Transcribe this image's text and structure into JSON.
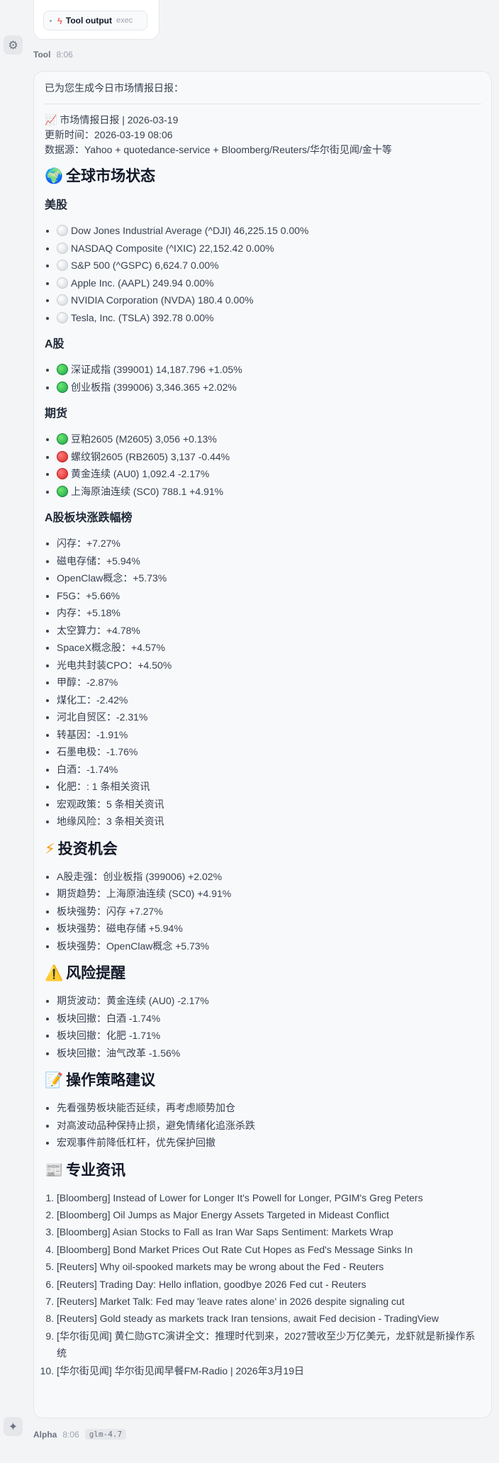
{
  "tool_card": {
    "label": "Tool output",
    "kind": "exec"
  },
  "tool_meta": {
    "name": "Tool",
    "time": "8:06"
  },
  "message": {
    "intro": "已为您生成今日市场情报日报：",
    "report_title": "📈 市场情报日报 | 2026-03-19",
    "updated": "更新时间：2026-03-19 08:06",
    "sources": "数据源：Yahoo + quotedance-service + Bloomberg/Reuters/华尔街见闻/金十等",
    "global": {
      "heading": "全球市场状态",
      "us": {
        "heading": "美股",
        "items": [
          {
            "status": "white",
            "text": "Dow Jones Industrial Average (^DJI) 46,225.15 0.00%"
          },
          {
            "status": "white",
            "text": "NASDAQ Composite (^IXIC) 22,152.42 0.00%"
          },
          {
            "status": "white",
            "text": "S&P 500 (^GSPC) 6,624.7 0.00%"
          },
          {
            "status": "white",
            "text": "Apple Inc. (AAPL) 249.94 0.00%"
          },
          {
            "status": "white",
            "text": "NVIDIA Corporation (NVDA) 180.4 0.00%"
          },
          {
            "status": "white",
            "text": "Tesla, Inc. (TSLA) 392.78 0.00%"
          }
        ]
      },
      "cn": {
        "heading": "A股",
        "items": [
          {
            "status": "green",
            "text": "深证成指 (399001) 14,187.796 +1.05%"
          },
          {
            "status": "green",
            "text": "创业板指 (399006) 3,346.365 +2.02%"
          }
        ]
      },
      "futures": {
        "heading": "期货",
        "items": [
          {
            "status": "green",
            "text": "豆粕2605 (M2605) 3,056 +0.13%"
          },
          {
            "status": "red",
            "text": "螺纹钢2605 (RB2605) 3,137 -0.44%"
          },
          {
            "status": "red",
            "text": "黄金连续 (AU0) 1,092.4 -2.17%"
          },
          {
            "status": "green",
            "text": "上海原油连续 (SC0) 788.1 +4.91%"
          }
        ]
      },
      "sectors": {
        "heading": "A股板块涨跌幅榜",
        "items": [
          "闪存：+7.27%",
          "磁电存储：+5.94%",
          "OpenClaw概念：+5.73%",
          "F5G：+5.66%",
          "内存：+5.18%",
          "太空算力：+4.78%",
          "SpaceX概念股：+4.57%",
          "光电共封装CPO：+4.50%",
          "甲醇：-2.87%",
          "煤化工：-2.42%",
          "河北自贸区：-2.31%",
          "转基因：-1.91%",
          "石墨电极：-1.76%",
          "白酒：-1.74%",
          "化肥：: 1 条相关资讯",
          "宏观政策：5 条相关资讯",
          "地缘风险：3 条相关资讯"
        ]
      }
    },
    "opportunities": {
      "heading": "投资机会",
      "items": [
        "A股走强：创业板指 (399006) +2.02%",
        "期货趋势：上海原油连续 (SC0) +4.91%",
        "板块强势：闪存 +7.27%",
        "板块强势：磁电存储 +5.94%",
        "板块强势：OpenClaw概念 +5.73%"
      ]
    },
    "risks": {
      "heading": "风险提醒",
      "items": [
        "期货波动：黄金连续 (AU0) -2.17%",
        "板块回撤：白酒 -1.74%",
        "板块回撤：化肥 -1.71%",
        "板块回撤：油气改革 -1.56%"
      ]
    },
    "strategy": {
      "heading": "操作策略建议",
      "items": [
        "先看强势板块能否延续，再考虑顺势加仓",
        "对高波动品种保持止损，避免情绪化追涨杀跌",
        "宏观事件前降低杠杆，优先保护回撤"
      ]
    },
    "news": {
      "heading": "专业资讯",
      "items": [
        "[Bloomberg] Instead of Lower for Longer It's Powell for Longer, PGIM's Greg Peters",
        "[Bloomberg] Oil Jumps as Major Energy Assets Targeted in Mideast Conflict",
        "[Bloomberg] Asian Stocks to Fall as Iran War Saps Sentiment: Markets Wrap",
        "[Bloomberg] Bond Market Prices Out Rate Cut Hopes as Fed's Message Sinks In",
        "[Reuters] Why oil-spooked markets may be wrong about the Fed - Reuters",
        "[Reuters] Trading Day: Hello inflation, goodbye 2026 Fed cut - Reuters",
        "[Reuters] Market Talk: Fed may 'leave rates alone' in 2026 despite signaling cut",
        "[Reuters] Gold steady as markets track Iran tensions, await Fed decision - TradingView",
        "[华尔街见闻] 黄仁勋GTC演讲全文：推理时代到来，2027营收至少万亿美元，龙虾就是新操作系统",
        "[华尔街见闻] 华尔街见闻早餐FM-Radio | 2026年3月19日"
      ]
    }
  },
  "assistant_meta": {
    "name": "Alpha",
    "time": "8:06",
    "model": "glm-4.7"
  },
  "icons": {
    "tool_avatar": "gear-icon",
    "assistant_avatar": "sparkle-icon",
    "tool_card": "lightning-icon",
    "global": "globe-icon",
    "opportunities": "lightning-icon",
    "risks": "warning-icon",
    "strategy": "memo-icon",
    "news": "newspaper-icon"
  }
}
